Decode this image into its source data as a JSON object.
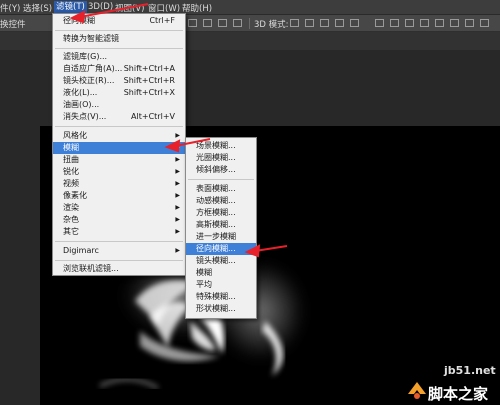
{
  "menubar": {
    "items": [
      {
        "label": "件(Y)"
      },
      {
        "label": "选择(S)"
      },
      {
        "label": "滤镜(T)"
      },
      {
        "label": "3D(D)"
      },
      {
        "label": "视图(V)"
      },
      {
        "label": "窗口(W)"
      },
      {
        "label": "帮助(H)"
      }
    ]
  },
  "optbar": {
    "left_label": "换控件",
    "mode_label": "3D 模式:"
  },
  "filter_menu": {
    "items": [
      {
        "label": "径向模糊",
        "shortcut": "Ctrl+F"
      },
      {
        "label": "转换为智能滤镜"
      },
      {
        "label": "滤镜库(G)..."
      },
      {
        "label": "自适应广角(A)...",
        "shortcut": "Shift+Ctrl+A"
      },
      {
        "label": "镜头校正(R)...",
        "shortcut": "Shift+Ctrl+R"
      },
      {
        "label": "液化(L)...",
        "shortcut": "Shift+Ctrl+X"
      },
      {
        "label": "油画(O)..."
      },
      {
        "label": "消失点(V)...",
        "shortcut": "Alt+Ctrl+V"
      },
      {
        "label": "风格化"
      },
      {
        "label": "模糊"
      },
      {
        "label": "扭曲"
      },
      {
        "label": "锐化"
      },
      {
        "label": "视频"
      },
      {
        "label": "像素化"
      },
      {
        "label": "渲染"
      },
      {
        "label": "杂色"
      },
      {
        "label": "其它"
      },
      {
        "label": "Digimarc"
      },
      {
        "label": "浏览联机滤镜..."
      }
    ]
  },
  "blur_submenu": {
    "items": [
      {
        "label": "场景模糊..."
      },
      {
        "label": "光圈模糊..."
      },
      {
        "label": "倾斜偏移..."
      },
      {
        "label": "表面模糊..."
      },
      {
        "label": "动感模糊..."
      },
      {
        "label": "方框模糊..."
      },
      {
        "label": "高斯模糊..."
      },
      {
        "label": "进一步模糊"
      },
      {
        "label": "径向模糊..."
      },
      {
        "label": "镜头模糊..."
      },
      {
        "label": "模糊"
      },
      {
        "label": "平均"
      },
      {
        "label": "特殊模糊..."
      },
      {
        "label": "形状模糊..."
      }
    ]
  },
  "watermark": {
    "site": "jb51.net",
    "name": "脚本之家"
  },
  "colors": {
    "highlight": "#3e7fd8",
    "arrow": "#e8202a"
  }
}
